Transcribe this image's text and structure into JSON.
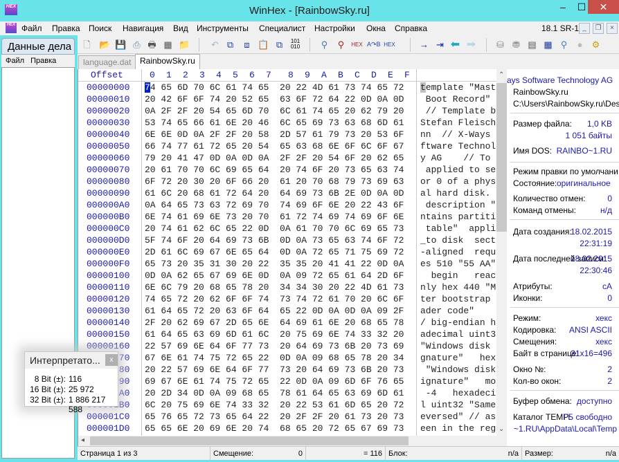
{
  "window": {
    "title": "WinHex - [RainbowSky.ru]",
    "app_icon": "HEX"
  },
  "menu": {
    "items": [
      "Файл",
      "Правка",
      "Поиск",
      "Навигация",
      "Вид",
      "Инструменты",
      "Специалист",
      "Настройки",
      "Окна",
      "Справка"
    ],
    "version": "18.1 SR-1"
  },
  "toolbar": {
    "icons": [
      "new-file-icon",
      "open-folder-icon",
      "save-icon",
      "print-preview-icon",
      "print-icon",
      "properties-icon",
      "open-folder-refresh-icon",
      "undo-icon",
      "copy-block-icon",
      "cut-paste-icon",
      "paste-icon",
      "copy-hex-icon",
      "binary-icon",
      "find-text-icon",
      "find-hex-icon",
      "find-hex-red-icon",
      "replace-text-icon",
      "replace-hex-icon",
      "goto-offset-icon",
      "goto-sector-icon",
      "back-icon",
      "forward-icon",
      "open-disk-icon",
      "open-drives-icon",
      "open-memory-icon",
      "calculator-icon",
      "zoom-icon",
      "camera-icon",
      "settings-gear-icon"
    ]
  },
  "case_panel": {
    "title": "Данные дела",
    "menu": [
      "Файл",
      "Правка"
    ]
  },
  "tabs": [
    {
      "label": "language.dat",
      "active": false
    },
    {
      "label": "RainbowSky.ru",
      "active": true
    }
  ],
  "hex_view": {
    "offset_header": "Offset",
    "column_headers": [
      "0",
      "1",
      "2",
      "3",
      "4",
      "5",
      "6",
      "7",
      "8",
      "9",
      "A",
      "B",
      "C",
      "D",
      "E",
      "F"
    ],
    "rows": [
      {
        "offset": "00000000",
        "hex": "74 65 6D 70 6C 61 74 65  20 22 4D 61 73 74 65 72",
        "ascii": "template \"Mast"
      },
      {
        "offset": "00000010",
        "hex": "20 42 6F 6F 74 20 52 65  63 6F 72 64 22 0D 0A 0D",
        "ascii": " Boot Record\""
      },
      {
        "offset": "00000020",
        "hex": "0A 2F 2F 20 54 65 6D 70  6C 61 74 65 20 62 79 20",
        "ascii": " // Template b"
      },
      {
        "offset": "00000030",
        "hex": "53 74 65 66 61 6E 20 46  6C 65 69 73 63 68 6D 61",
        "ascii": "Stefan Fleisch"
      },
      {
        "offset": "00000040",
        "hex": "6E 6E 0D 0A 2F 2F 20 58  2D 57 61 79 73 20 53 6F",
        "ascii": "nn  // X-Ways"
      },
      {
        "offset": "00000050",
        "hex": "66 74 77 61 72 65 20 54  65 63 68 6E 6F 6C 6F 67",
        "ascii": "ftware Technol"
      },
      {
        "offset": "00000060",
        "hex": "79 20 41 47 0D 0A 0D 0A  2F 2F 20 54 6F 20 62 65",
        "ascii": "y AG    // To"
      },
      {
        "offset": "00000070",
        "hex": "20 61 70 70 6C 69 65 64  20 74 6F 20 73 65 63 74",
        "ascii": " applied to se"
      },
      {
        "offset": "00000080",
        "hex": "6F 72 20 30 20 6F 66 20  61 20 70 68 79 73 69 63",
        "ascii": "or 0 of a phys"
      },
      {
        "offset": "00000090",
        "hex": "61 6C 20 68 61 72 64 20  64 69 73 6B 2E 0D 0A 0D",
        "ascii": "al hard disk."
      },
      {
        "offset": "000000A0",
        "hex": "0A 64 65 73 63 72 69 70  74 69 6F 6E 20 22 43 6F",
        "ascii": " description \""
      },
      {
        "offset": "000000B0",
        "hex": "6E 74 61 69 6E 73 20 70  61 72 74 69 74 69 6F 6E",
        "ascii": "ntains partiti"
      },
      {
        "offset": "000000C0",
        "hex": "20 74 61 62 6C 65 22 0D  0A 61 70 70 6C 69 65 73",
        "ascii": " table\"  appli"
      },
      {
        "offset": "000000D0",
        "hex": "5F 74 6F 20 64 69 73 6B  0D 0A 73 65 63 74 6F 72",
        "ascii": "_to disk  sect"
      },
      {
        "offset": "000000E0",
        "hex": "2D 61 6C 69 67 6E 65 64  0D 0A 72 65 71 75 69 72",
        "ascii": "-aligned  requ"
      },
      {
        "offset": "000000F0",
        "hex": "65 73 20 35 31 30 20 22  35 35 20 41 41 22 0D 0A",
        "ascii": "es 510 \"55 AA\""
      },
      {
        "offset": "00000100",
        "hex": "0D 0A 62 65 67 69 6E 0D  0A 09 72 65 61 64 2D 6F",
        "ascii": "  begin   reac"
      },
      {
        "offset": "00000110",
        "hex": "6E 6C 79 20 68 65 78 20  34 34 30 20 22 4D 61 73",
        "ascii": "nly hex 440 \"M"
      },
      {
        "offset": "00000120",
        "hex": "74 65 72 20 62 6F 6F 74  73 74 72 61 70 20 6C 6F",
        "ascii": "ter bootstrap"
      },
      {
        "offset": "00000130",
        "hex": "61 64 65 72 20 63 6F 64  65 22 0D 0A 0D 0A 09 2F",
        "ascii": "ader code\""
      },
      {
        "offset": "00000140",
        "hex": "2F 20 62 69 67 2D 65 6E  64 69 61 6E 20 68 65 78",
        "ascii": "/ big-endian h"
      },
      {
        "offset": "00000150",
        "hex": "61 64 65 63 69 6D 61 6C  20 75 69 6E 74 33 32 20",
        "ascii": "adecimal uint3"
      },
      {
        "offset": "00000160",
        "hex": "22 57 69 6E 64 6F 77 73  20 64 69 73 6B 20 73 69",
        "ascii": "\"Windows disk"
      },
      {
        "offset": "00000170",
        "hex": "67 6E 61 74 75 72 65 22  0D 0A 09 68 65 78 20 34",
        "ascii": "gnature\"   hex"
      },
      {
        "offset": "00000180",
        "hex": "20 22 57 69 6E 64 6F 77  73 20 64 69 73 6B 20 73",
        "ascii": " \"Windows disk"
      },
      {
        "offset": "00000190",
        "hex": "69 67 6E 61 74 75 72 65  22 0D 0A 09 6D 6F 76 65",
        "ascii": "ignature\"   mo"
      },
      {
        "offset": "000001A0",
        "hex": "20 2D 34 0D 0A 09 68 65  78 61 64 65 63 69 6D 61",
        "ascii": " -4   hexadeci"
      },
      {
        "offset": "000001B0",
        "hex": "6C 20 75 69 6E 74 33 32  20 22 53 61 6D 65 20 72",
        "ascii": "l uint32 \"Same"
      },
      {
        "offset": "000001C0",
        "hex": "65 76 65 72 73 65 64 22  20 2F 2F 20 61 73 20 73",
        "ascii": "eversed\" // as"
      },
      {
        "offset": "000001D0",
        "hex": "65 65 6E 20 69 6E 20 74  68 65 20 72 65 67 69 73",
        "ascii": "een in the reg"
      }
    ],
    "cursor_byte": "7",
    "cursor_rest": "4"
  },
  "info_pane": {
    "company": "ays Software Technology AG",
    "user": "RainbowSky.ru",
    "path": "C:\\Users\\RainbowSky.ru\\Des",
    "file_size_label": "Размер файла:",
    "file_size_kb": "1,0 KB",
    "file_size_bytes": "1 051 байты",
    "dos_name_label": "Имя DOS:",
    "dos_name": "RAINBO~1.RU",
    "edit_mode_label": "Режим правки по умолчани",
    "state_label": "Состояние:",
    "state": "оригинальное",
    "undo_count_label": "Количество отмен:",
    "undo_count": "0",
    "undo_cmds_label": "Команд отмены:",
    "undo_cmds": "н/д",
    "created_label": "Дата создания:",
    "created_date": "18.02.2015",
    "created_time": "22:31:19",
    "modified_label": "Дата последней записи:",
    "modified_date": "18.02.2015",
    "modified_time": "22:30:46",
    "attributes_label": "Атрибуты:",
    "attributes": "cA",
    "icons_label": "Иконки:",
    "icons": "0",
    "mode_label": "Режим:",
    "mode": "хекс",
    "encoding_label": "Кодировка:",
    "encoding": "ANSI ASCII",
    "offsets_label": "Смещения:",
    "offsets": "хекс",
    "bytes_page_label": "Байт в странице:",
    "bytes_page": "31x16=496",
    "window_no_label": "Окно №:",
    "window_no": "2",
    "window_count_label": "Кол-во окон:",
    "window_count": "2",
    "clipboard_label": "Буфер обмена:",
    "clipboard": "доступно",
    "temp_label": "Каталог TEMP:",
    "temp_free": "ГБ свободно",
    "temp_path": "~1.RU\\AppData\\Local\\Temp"
  },
  "interpreter": {
    "title": "Интерпретато...",
    "rows": [
      {
        "label": "8 Bit (±):",
        "value": "116"
      },
      {
        "label": "16 Bit (±):",
        "value": "25 972"
      },
      {
        "label": "32 Bit (±):",
        "value": "1 886 217 588"
      }
    ]
  },
  "status_bar": {
    "page": "Страница 1 из 3",
    "offset_label": "Смещение:",
    "offset": "0",
    "value": "= 116",
    "block_label": "Блок:",
    "block": "n/a",
    "size_label": "Размер:",
    "size": "n/a"
  }
}
